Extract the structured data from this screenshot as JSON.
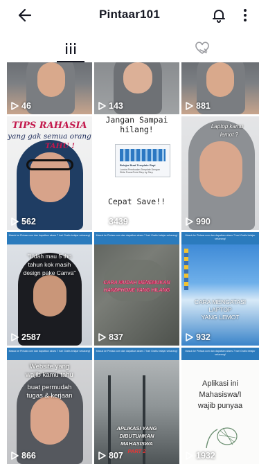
{
  "header": {
    "title": "Pintaar101"
  },
  "tabs": [
    {
      "id": "videos",
      "icon": "grid-icon",
      "active": true
    },
    {
      "id": "liked",
      "icon": "heart-off-icon",
      "active": false
    }
  ],
  "tiles": [
    {
      "views": "46"
    },
    {
      "views": "143"
    },
    {
      "views": "881"
    },
    {
      "views": "562",
      "text_top": "TIPS RAHASIA",
      "text_sub": "yang gak semua orang",
      "text_sub2": "TAHU !"
    },
    {
      "views": "3439",
      "text_top": "Jangan Sampai",
      "text_sub": "hilang!",
      "text_caption": "Cepat Save!!",
      "slide_caption": "Belajar Buat Template Rapi",
      "slide_sub": "Lomba Pembuatan Template Dengan Slide PowerPoint Step by Step"
    },
    {
      "views": "990",
      "text_top": "Laptop kamu",
      "text_sub": "lemot ?"
    },
    {
      "views": "2587",
      "text_top": "\"Udah mau 5 thn",
      "text_sub": "tahun kok masih",
      "text_sub2": "design pake Canva\"",
      "banner": "Masuk ke Pintaar.com dan dapatkan akses 7 hari Gratis belajar sekarang!"
    },
    {
      "views": "837",
      "text_top": "CARA MUDAH MENEMUKAN",
      "text_sub": "HANDPHONE YANG HILANG",
      "banner": "Masuk ke Pintaar.com dan dapatkan akses 7 hari Gratis belajar sekarang!"
    },
    {
      "views": "932",
      "text_top": "CARA MENGATASI",
      "text_sub": "LAPTOP",
      "text_sub2": "YANG LEMOT",
      "banner": "Masuk ke Pintaar.com dan dapatkan akses 7 hari Gratis belajar sekarang!"
    },
    {
      "views": "866",
      "text_top": "Website yang",
      "text_sub": "wajib kamu tahu",
      "text_sub2": "buat permudah",
      "text_sub3": "tugas & kerjaan",
      "banner": "Masuk ke Pintaar.com dan dapatkan akses 7 hari Gratis belajar sekarang!"
    },
    {
      "views": "807",
      "text_top": "APLIKASI YANG",
      "text_sub": "DIBUTUHKAN",
      "text_sub2": "MAHASISWA",
      "text_sub3": "PART 2",
      "banner": "Masuk ke Pintaar.com dan dapatkan akses 7 hari Gratis belajar sekarang!"
    },
    {
      "views": "1932",
      "text_top": "Aplikasi ini",
      "text_sub": "Mahasiswa/I",
      "text_sub2": "wajib punyaa",
      "banner": "Masuk ke Pintaar.com dan dapatkan akses 7 hari Gratis belajar sekarang!"
    }
  ]
}
